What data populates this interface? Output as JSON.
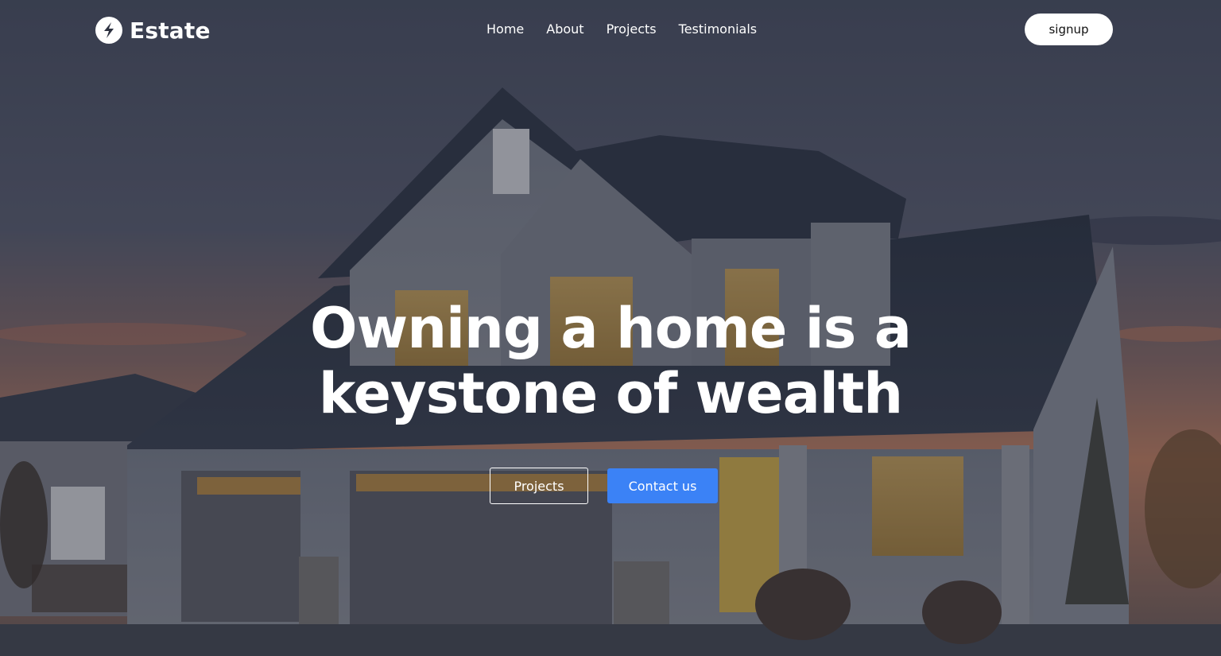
{
  "brand": {
    "name": "Estate",
    "logo_icon": "lightning-bolt-icon"
  },
  "nav": {
    "items": [
      {
        "label": "Home"
      },
      {
        "label": "About"
      },
      {
        "label": "Projects"
      },
      {
        "label": "Testimonials"
      }
    ]
  },
  "header": {
    "signup_label": "signup"
  },
  "hero": {
    "headline_line1": "Owning a home is a",
    "headline_line2": "keystone of wealth",
    "primary_button": "Projects",
    "secondary_button": "Contact us",
    "background": "house-at-dusk-photo"
  },
  "colors": {
    "accent": "#3b82f6",
    "text": "#ffffff"
  }
}
